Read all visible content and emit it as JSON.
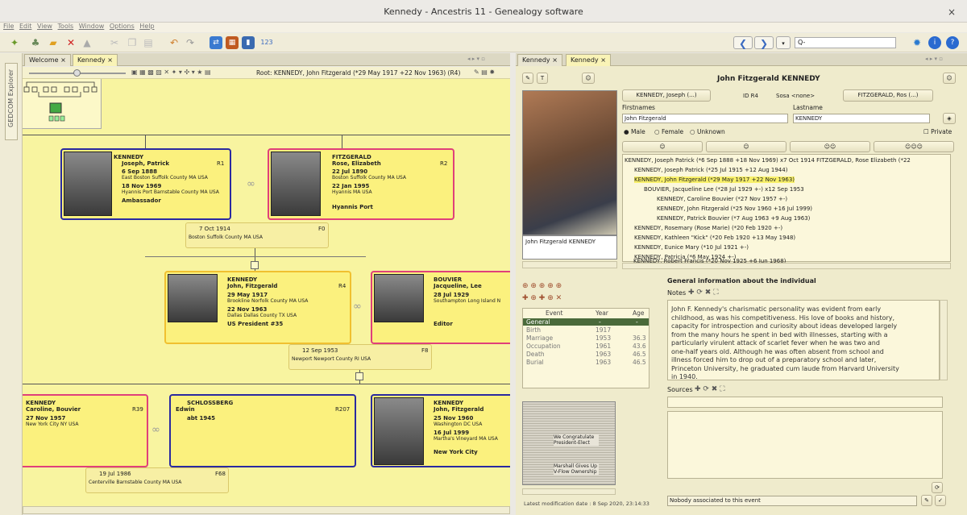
{
  "window": {
    "title": "Kennedy - Ancestris 11 - Genealogy software",
    "close": "×"
  },
  "menu": [
    "File",
    "Edit",
    "View",
    "Tools",
    "Window",
    "Options",
    "Help"
  ],
  "sidebar": {
    "label": "GEDCOM Explorer"
  },
  "left_tabs": [
    {
      "label": "Welcome ×"
    },
    {
      "label": "Kennedy ×"
    }
  ],
  "right_tabs": [
    {
      "label": "Kennedy ×"
    },
    {
      "label": "Kennedy ×"
    }
  ],
  "tree_toolbar": {
    "root": "Root: KENNEDY, John Fitzgerald (*29 May 1917 +22 Nov 1963) (R4)"
  },
  "tree": {
    "joseph": {
      "surname": "KENNEDY",
      "given": "Joseph, Patrick",
      "id": "R1",
      "birth": "6 Sep 1888",
      "birth_place": "East Boston Suffolk County MA USA",
      "death": "18 Nov 1969",
      "death_place": "Hyannis Port Barnstable County MA USA",
      "occ": "Ambassador"
    },
    "rose": {
      "surname": "FITZGERALD",
      "given": "Rose, Elizabeth",
      "id": "R2",
      "birth": "22 Jul 1890",
      "birth_place": "Boston Suffolk County MA USA",
      "death": "22 Jan 1995",
      "death_place": "Hyannis MA USA",
      "res": "Hyannis Port"
    },
    "fam0": {
      "date": "7 Oct 1914",
      "place": "Boston Suffolk County MA USA",
      "id": "F0"
    },
    "john": {
      "surname": "KENNEDY",
      "given": "John, Fitzgerald",
      "id": "R4",
      "birth": "29 May 1917",
      "birth_place": "Brookline Norfolk County MA USA",
      "death": "22 Nov 1963",
      "death_place": "Dallas Dallas County TX USA",
      "occ": "US President #35"
    },
    "jackie": {
      "surname": "BOUVIER",
      "given": "Jacqueline, Lee",
      "birth": "28 Jul 1929",
      "birth_place": "Southampton Long Island N",
      "occ": "Editor"
    },
    "fam8": {
      "date": "12 Sep 1953",
      "place": "Newport Newport County RI USA",
      "id": "F8"
    },
    "caroline": {
      "surname": "KENNEDY",
      "given": "Caroline, Bouvier",
      "id": "R39",
      "birth": "27 Nov 1957",
      "birth_place": "New York City NY USA"
    },
    "edwin": {
      "surname": "SCHLOSSBERG",
      "given": "Edwin",
      "id": "R207",
      "marr": "abt 1945"
    },
    "johnjr": {
      "surname": "KENNEDY",
      "given": "John, Fitzgerald",
      "birth": "25 Nov 1960",
      "birth_place": "Washington DC USA",
      "death": "16 Jul 1999",
      "death_place": "Martha's Vineyard MA USA",
      "res": "New York City"
    },
    "fam68": {
      "date": "19 Jul 1986",
      "place": "Centerville Barnstable County MA USA",
      "id": "F68"
    }
  },
  "person": {
    "full_name": "John Fitzgerald KENNEDY",
    "father_btn": "KENNEDY, Joseph (...)",
    "mother_btn": "FITZGERALD, Ros (...)",
    "id_text": "ID R4",
    "sosa": "Sosa <none>",
    "firstnames_label": "Firstnames",
    "lastname_label": "Lastname",
    "firstname": "John Fitzgerald",
    "lastname": "KENNEDY",
    "sex_male": "Male",
    "sex_female": "Female",
    "sex_unknown": "Unknown",
    "private": "Private",
    "photo_caption": "John Fitzgerald KENNEDY"
  },
  "family_tree": [
    "KENNEDY, Joseph Patrick (*6 Sep 1888 +18 Nov 1969) x7 Oct 1914 FITZGERALD, Rose Elizabeth (*22",
    "KENNEDY, Joseph Patrick (*25 Jul 1915 +12 Aug 1944)",
    "KENNEDY, John Fitzgerald (*29 May 1917 +22 Nov 1963)",
    "BOUVIER, Jacqueline Lee (*28 Jul 1929 +-) x12 Sep 1953",
    "KENNEDY, Caroline Bouvier (*27 Nov 1957 +-)",
    "KENNEDY, John Fitzgerald (*25 Nov 1960 +16 Jul 1999)",
    "KENNEDY, Patrick Bouvier (*7 Aug 1963 +9 Aug 1963)",
    "KENNEDY, Rosemary (Rose Marie) (*20 Feb 1920 +-)",
    "KENNEDY, Kathleen \"Kick\" (*20 Feb 1920 +13 May 1948)",
    "KENNEDY, Eunice Mary (*10 Jul 1921 +-)",
    "KENNEDY, Patricia (*6 May 1924 +-)",
    "KENNEDY, Robert Francis (*20 Nov 1925 +6 Jun 1968)"
  ],
  "events": {
    "headers": [
      "Event",
      "Year",
      "Age"
    ],
    "rows": [
      {
        "event": "General",
        "year": "-",
        "age": "-"
      },
      {
        "event": "Birth",
        "year": "1917",
        "age": ""
      },
      {
        "event": "Marriage",
        "year": "1953",
        "age": "36.3"
      },
      {
        "event": "Occupation",
        "year": "1961",
        "age": "43.6"
      },
      {
        "event": "Death",
        "year": "1963",
        "age": "46.5"
      },
      {
        "event": "Burial",
        "year": "1963",
        "age": "46.5"
      }
    ]
  },
  "general": {
    "title": "General information about the individual",
    "notes_label": "Notes",
    "sources_label": "Sources",
    "note_lines": [
      "John F. Kennedy's charismatic personality was evident from early",
      "childhood, as was his competitiveness. His love of books and history,",
      "capacity for introspection and curiosity about ideas developed largely",
      "from the many hours he spent in bed with illnesses, starting with a",
      "particularly virulent attack of scarlet fever when he was two and",
      "one-half years old. Although he was often absent from school and",
      "illness forced him to drop out of a preparatory school and later,",
      "Princeton University, he graduated cum laude from Harvard University",
      "in 1940."
    ],
    "associated": "Nobody associated to this event"
  },
  "newspaper": {
    "headline1": "We Congratulate President-Elect",
    "headline2": "Marshall Gives Up V-Flow Ownership"
  },
  "status": {
    "last_mod": "Latest modification date : 8 Sep 2020, 23:14:33"
  },
  "search": {
    "placeholder": "Q-"
  }
}
